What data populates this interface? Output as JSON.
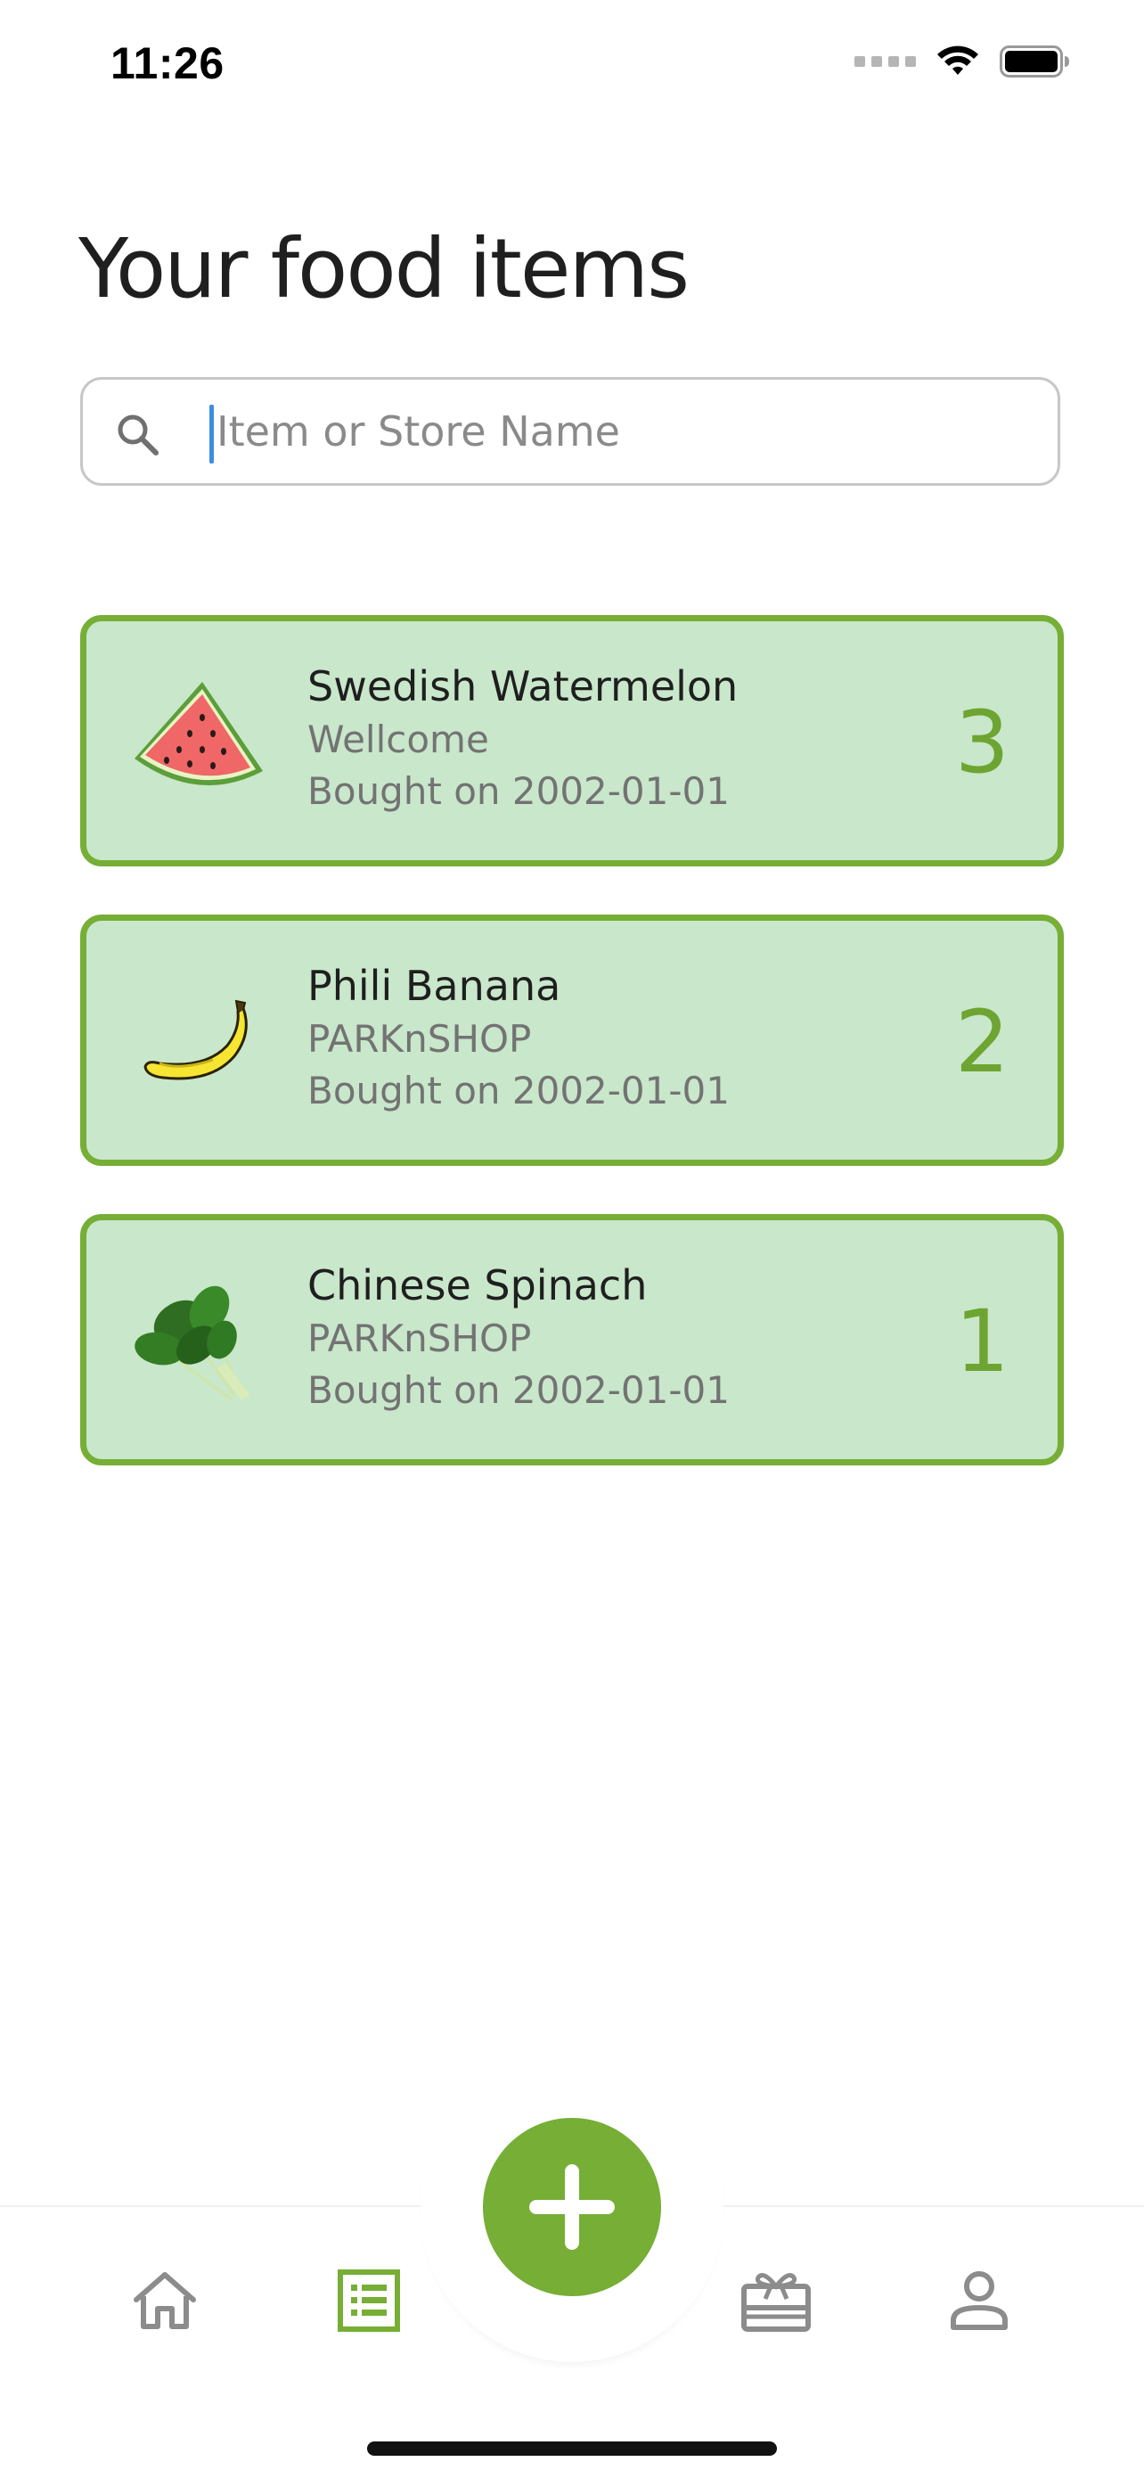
{
  "status_bar": {
    "time": "11:26",
    "icons": [
      "cellular-signal-icon",
      "wifi-icon",
      "battery-icon"
    ]
  },
  "header": {
    "title": "Your food items"
  },
  "search": {
    "value": "",
    "placeholder": "Item or Store Name",
    "icon": "search-icon"
  },
  "food_items": [
    {
      "name": "Swedish Watermelon",
      "store": "Wellcome",
      "bought": "Bought on 2002-01-01",
      "quantity": "3",
      "image": "watermelon-image"
    },
    {
      "name": "Phili Banana",
      "store": "PARKnSHOP",
      "bought": "Bought on 2002-01-01",
      "quantity": "2",
      "image": "banana-image"
    },
    {
      "name": "Chinese Spinach",
      "store": "PARKnSHOP",
      "bought": "Bought on 2002-01-01",
      "quantity": "1",
      "image": "spinach-image"
    }
  ],
  "bottom_nav": {
    "items": [
      {
        "icon": "home-icon",
        "active": false
      },
      {
        "icon": "list-icon",
        "active": true
      },
      {
        "icon": "add-icon",
        "active": false
      },
      {
        "icon": "gift-card-icon",
        "active": false
      },
      {
        "icon": "profile-icon",
        "active": false
      }
    ]
  },
  "colors": {
    "accent": "#76ae36",
    "card_background": "#c9e7cb",
    "quantity": "#6ea431",
    "inactive_icon": "#8c8c8c"
  }
}
